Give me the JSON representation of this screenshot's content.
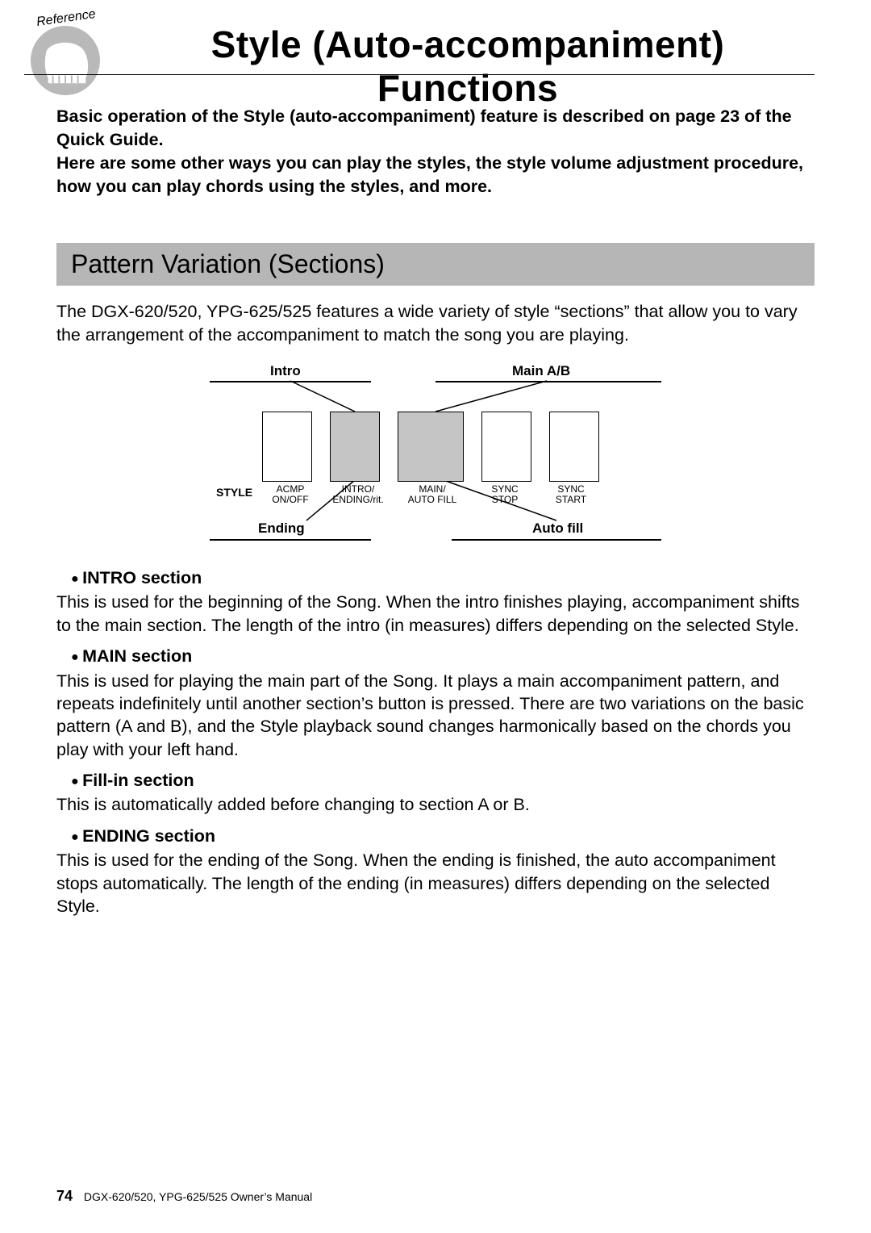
{
  "header": {
    "reference_badge": "Reference",
    "title": "Style (Auto-accompaniment) Functions"
  },
  "lead": "Basic operation of the Style (auto-accompaniment) feature is described on page 23 of the Quick Guide.\nHere are some other ways you can play the styles, the style volume adjustment procedure, how you can play chords using the styles, and more.",
  "section": {
    "heading": "Pattern Variation (Sections)",
    "intro": "The DGX-620/520, YPG-625/525 features a wide variety of style “sections” that allow you to vary the arrangement of the accompaniment to match the song you are playing."
  },
  "diagram": {
    "top_labels": {
      "intro": "Intro",
      "main": "Main A/B"
    },
    "style_label": "STYLE",
    "buttons": [
      {
        "line1": "ACMP",
        "line2": "ON/OFF"
      },
      {
        "line1": "INTRO/",
        "line2": "ENDING/rit."
      },
      {
        "line1": "MAIN/",
        "line2": "AUTO FILL"
      },
      {
        "line1": "SYNC",
        "line2": "STOP"
      },
      {
        "line1": "SYNC",
        "line2": "START"
      }
    ],
    "bottom_labels": {
      "ending": "Ending",
      "autofill": "Auto fill"
    }
  },
  "definitions": [
    {
      "head": "INTRO section",
      "body": "This is used for the beginning of the Song. When the intro ﬁnishes playing, accompaniment shifts to the main section. The length of the intro (in measures) differs depending on the selected Style."
    },
    {
      "head": "MAIN section",
      "body": "This is used for playing the main part of the Song. It plays a main accompaniment pattern, and repeats indeﬁnitely until another section’s button is pressed. There are two variations on the basic pattern (A and B), and the Style playback sound changes harmonically based on the chords you play with your left hand."
    },
    {
      "head": "Fill-in section",
      "body": "This is automatically added before changing to section A or B."
    },
    {
      "head": "ENDING section",
      "body": "This is used for the ending of the Song. When the ending is ﬁnished, the auto accompaniment stops automatically. The length of the ending (in measures) differs depending on the selected Style."
    }
  ],
  "footer": {
    "page": "74",
    "manual": "DGX-620/520, YPG-625/525  Owner’s Manual"
  }
}
